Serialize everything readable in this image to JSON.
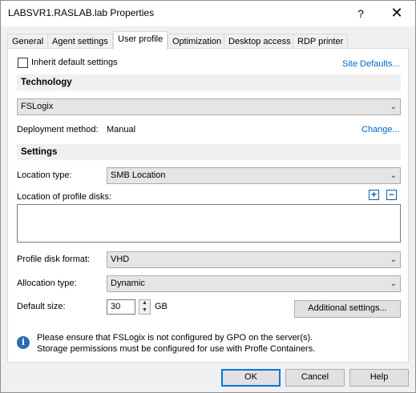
{
  "window": {
    "title": "LABSVR1.RASLAB.lab Properties",
    "help_glyph": "?",
    "close_glyph": "✕"
  },
  "tabs": [
    {
      "label": "General"
    },
    {
      "label": "Agent settings"
    },
    {
      "label": "User profile",
      "active": true
    },
    {
      "label": "Optimization"
    },
    {
      "label": "Desktop access"
    },
    {
      "label": "RDP printer"
    }
  ],
  "inherit": {
    "label": "Inherit default settings",
    "checked": false
  },
  "site_defaults_link": "Site Defaults...",
  "technology": {
    "heading": "Technology",
    "selected": "FSLogix",
    "deployment_label": "Deployment method:",
    "deployment_value": "Manual",
    "change_link": "Change..."
  },
  "settings": {
    "heading": "Settings",
    "location_type_label": "Location type:",
    "location_type_value": "SMB Location",
    "profile_disks_label": "Location of profile disks:",
    "profile_disks_value": "",
    "disk_format_label": "Profile disk format:",
    "disk_format_value": "VHD",
    "allocation_label": "Allocation type:",
    "allocation_value": "Dynamic",
    "default_size_label": "Default size:",
    "default_size_value": "30",
    "default_size_unit": "GB",
    "additional_button": "Additional settings..."
  },
  "info": {
    "line1": "Please ensure that FSLogix is not configured by GPO on the server(s).",
    "line2": "Storage permissions must be configured for use with Profle Containers."
  },
  "footer": {
    "ok": "OK",
    "cancel": "Cancel",
    "help": "Help"
  },
  "colors": {
    "accent": "#0078d7",
    "link": "#0066cc",
    "info_icon": "#2b6cb0"
  }
}
